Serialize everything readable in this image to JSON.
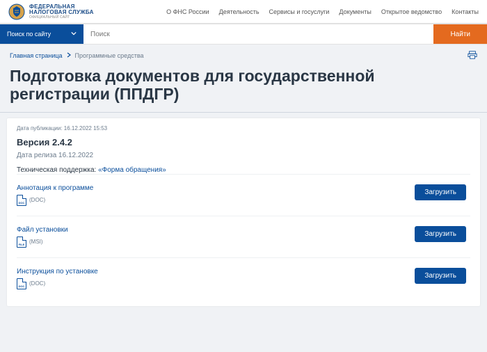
{
  "header": {
    "logo_line1": "ФЕДЕРАЛЬНАЯ",
    "logo_line2": "НАЛОГОВАЯ СЛУЖБА",
    "logo_sub": "ОФИЦИАЛЬНЫЙ САЙТ",
    "nav": [
      "О ФНС России",
      "Деятельность",
      "Сервисы и госуслуги",
      "Документы",
      "Открытое ведомство",
      "Контакты"
    ]
  },
  "search": {
    "scope": "Поиск по сайту",
    "placeholder": "Поиск",
    "button": "Найти"
  },
  "breadcrumbs": {
    "home": "Главная страница",
    "current": "Программные средства"
  },
  "page_title": "Подготовка документов для государственной регистрации (ППДГР)",
  "content": {
    "pub_label": "Дата публикации: 16.12.2022 15:53",
    "version": "Версия 2.4.2",
    "release": "Дата релиза 16.12.2022",
    "support_label": "Техническая поддержка:",
    "support_link": "«Форма обращения»"
  },
  "downloads": [
    {
      "title": "Аннотация к программе",
      "doc_badge": "DOC",
      "ext": "(DOC)",
      "button": "Загрузить"
    },
    {
      "title": "Файл установки",
      "doc_badge": "FILE",
      "ext": "(MSI)",
      "button": "Загрузить"
    },
    {
      "title": "Инструкция по установке",
      "doc_badge": "DOC",
      "ext": "(DOC)",
      "button": "Загрузить"
    }
  ]
}
